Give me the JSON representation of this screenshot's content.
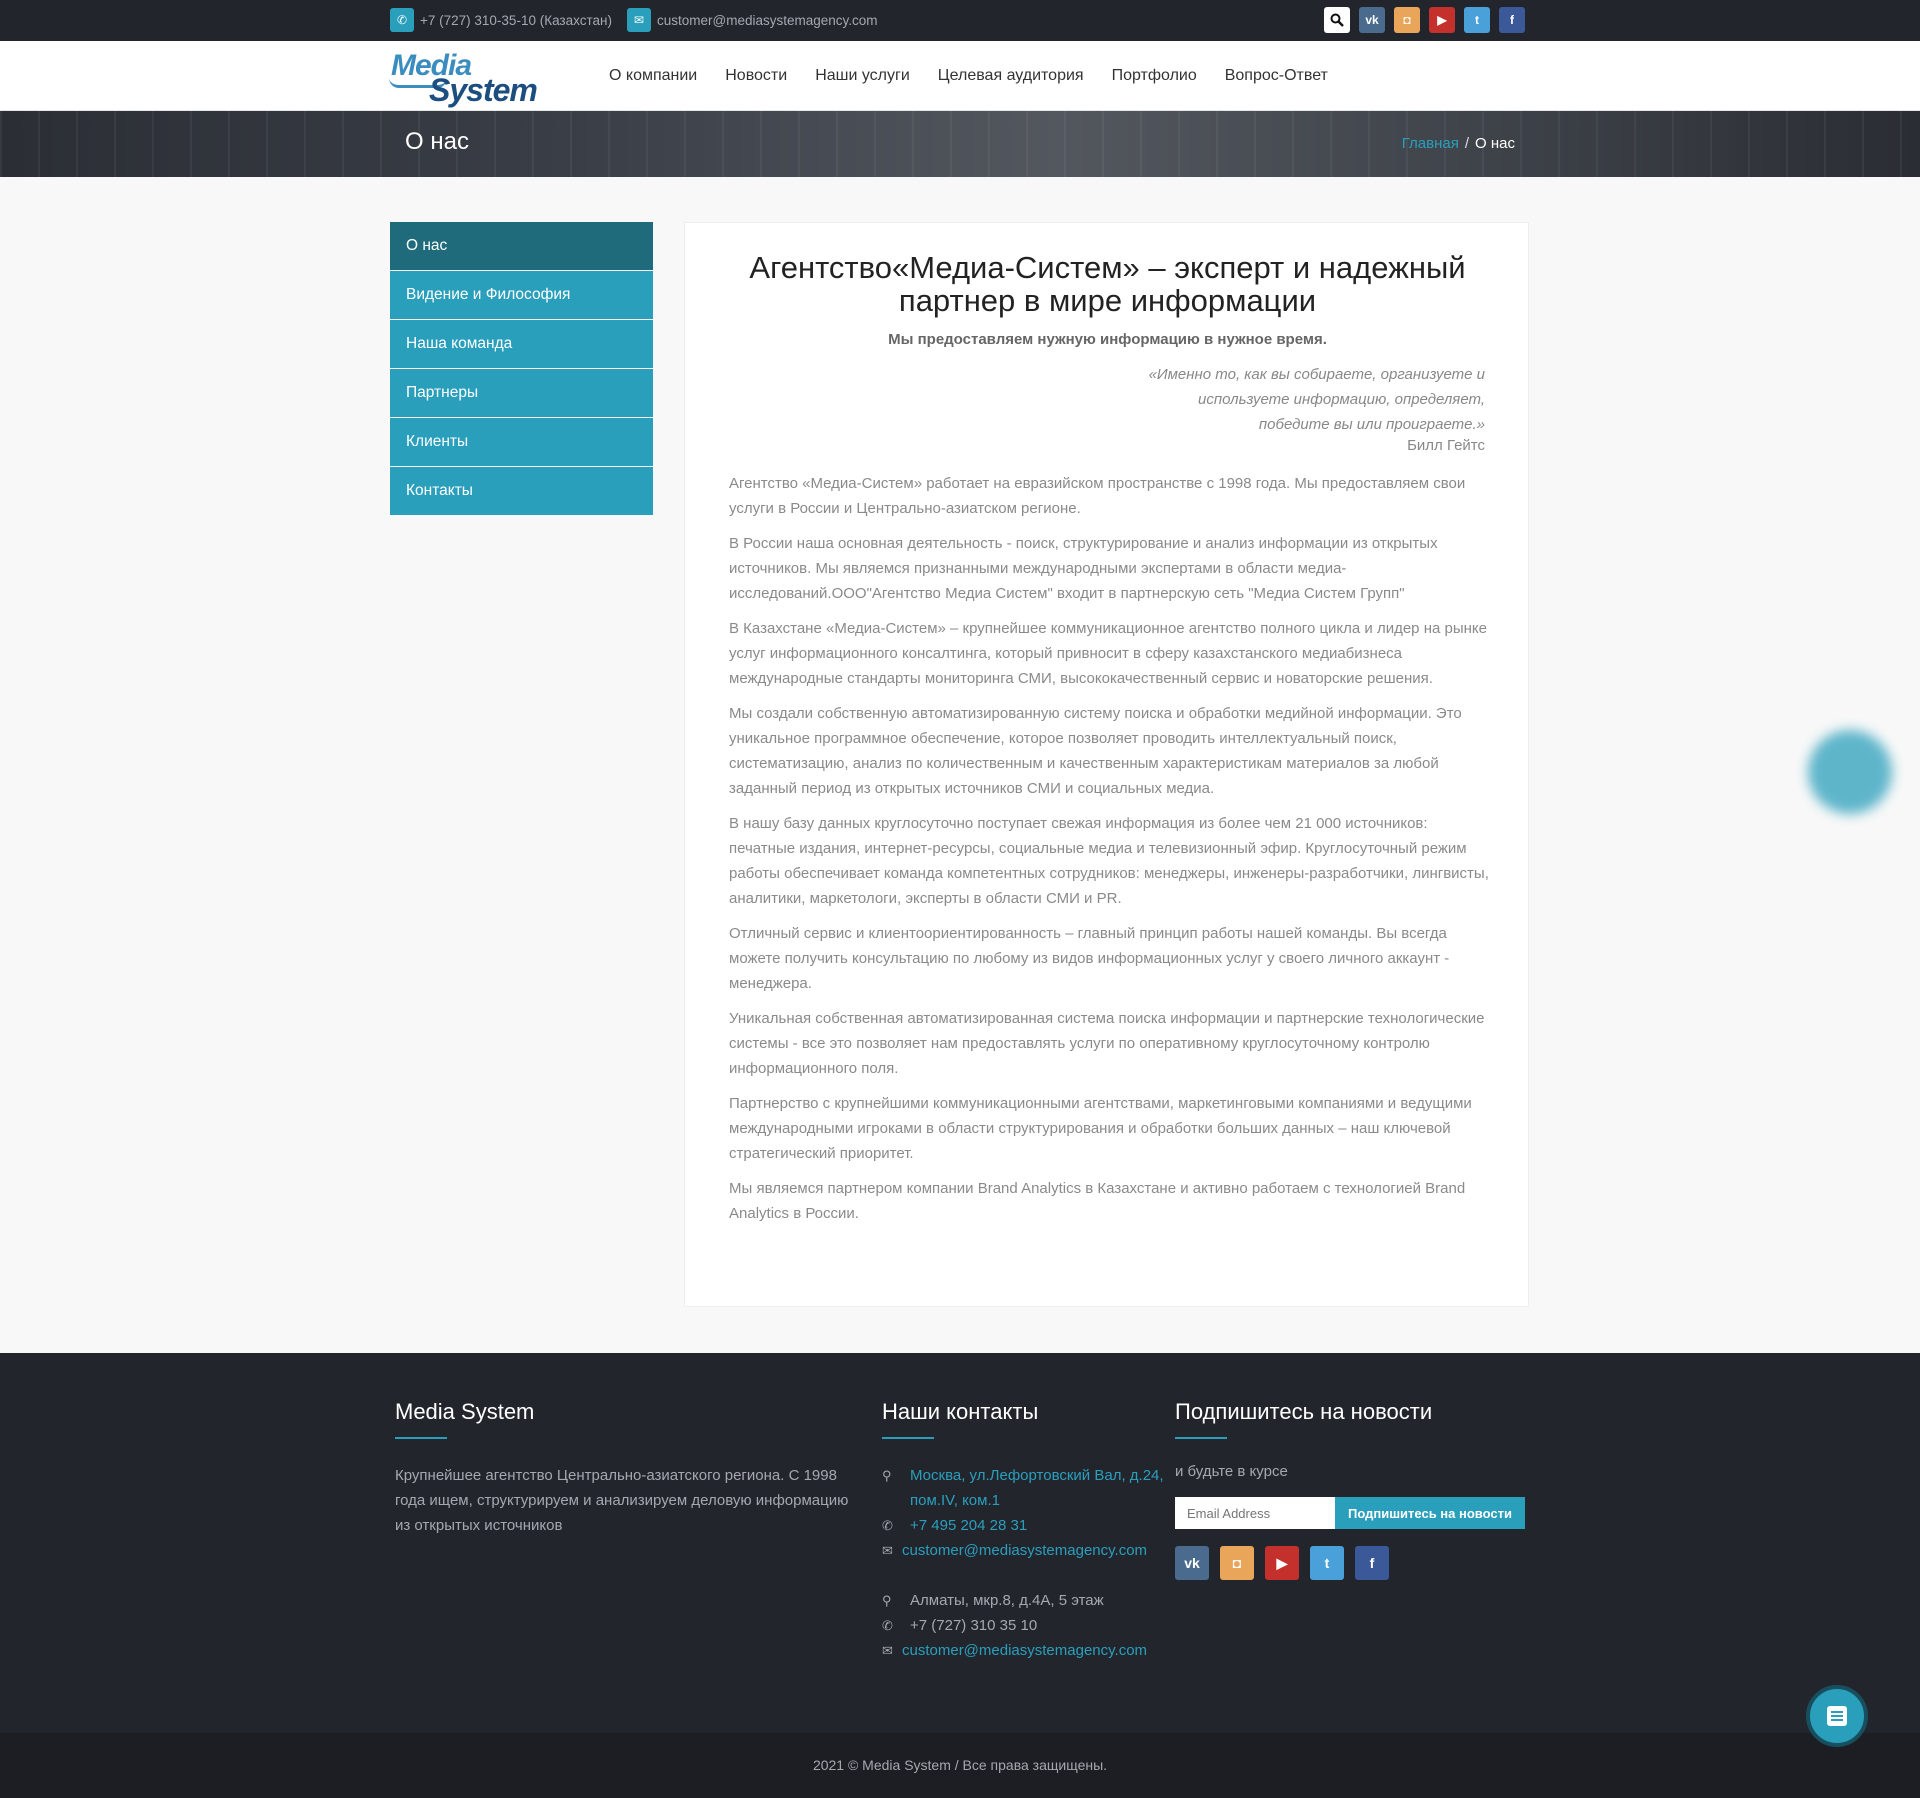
{
  "topbar": {
    "phone": "+7 (727) 310-35-10 (Казахстан)",
    "email": "customer@mediasystemagency.com",
    "icons": [
      "search-icon",
      "vk-icon",
      "instagram-icon",
      "youtube-icon",
      "twitter-icon",
      "facebook-icon"
    ]
  },
  "logo": {
    "line1": "Media",
    "line2": "System"
  },
  "nav": [
    "О компании",
    "Новости",
    "Наши услуги",
    "Целевая аудитория",
    "Портфолио",
    "Вопрос-Ответ"
  ],
  "page_title": "О нас",
  "breadcrumb": {
    "home": "Главная",
    "separator": "/",
    "current": "О нас"
  },
  "sidebar": [
    "О нас",
    "Видение и Философия",
    "Наша команда",
    "Партнеры",
    "Клиенты",
    "Контакты"
  ],
  "content": {
    "heading": "Агентство«Медиа-Систем» – эксперт и надежный партнер в мире информации",
    "lead": "Мы предоставляем нужную информацию в нужное время.",
    "quote": "«Именно то, как вы собираете, организуете и используете информацию, определяет, победите вы или проиграете.»",
    "quote_author": "Билл Гейтс",
    "paragraphs": [
      "Агентство «Медиа-Систем» работает на евразийском пространстве с 1998 года. Мы предоставляем свои услуги в России и Центрально-азиатском регионе.",
      "В России наша основная деятельность - поиск, структурирование и анализ информации из открытых источников. Мы являемся признанными международными экспертами в области медиа-исследований.ООО\"Агентство Медиа Систем\" входит в партнерскую сеть \"Медиа Систем Групп\"",
      "В Казахстане «Медиа-Систем» – крупнейшее коммуникационное агентство полного цикла и лидер на рынке услуг информационного консалтинга, который привносит в сферу казахстанского медиабизнеса международные стандарты мониторинга СМИ, высококачественный сервис и новаторские решения.",
      "Мы создали собственную автоматизированную систему поиска и обработки медийной информации. Это уникальное программное обеспечение, которое позволяет проводить интеллектуальный поиск, систематизацию, анализ по количественным и качественным характеристикам материалов за любой заданный период из открытых источников СМИ и социальных медиа.",
      "В нашу базу данных круглосуточно поступает свежая информация из более чем 21 000 источников: печатные издания, интернет-ресурсы, социальные медиа и телевизионный эфир. Круглосуточный режим работы обеспечивает команда компетентных сотрудников: менеджеры, инженеры-разработчики, лингвисты, аналитики, маркетологи, эксперты в области СМИ и PR.",
      "Отличный сервис и клиентоориентированность – главный принцип работы нашей команды. Вы всегда можете получить консультацию по любому из видов информационных услуг у своего личного аккаунт - менеджера.",
      "Уникальная собственная автоматизированная система поиска информации и партнерские технологические системы - все это позволяет нам предоставлять услуги по оперативному круглосуточному контролю информационного поля.",
      "Партнерство с крупнейшими коммуникационными агентствами, маркетинговыми компаниями и ведущими международными игроками в области структурирования и обработки больших данных – наш ключевой стратегический приоритет.",
      "Мы являемся партнером компании Brand Analytics в Казахстане и активно работаем с технологией Brand Analytics в России."
    ]
  },
  "footer": {
    "about_title": "Media System",
    "about_text": "Крупнейшее агентство Центрально-азиатского региона. С 1998 года ищем, структурируем и анализируем деловую информацию из открытых источников",
    "contacts_title": "Наши контакты",
    "moscow_address": "Москва, ул.Лефортовский Вал, д.24, пом.IV, ком.1",
    "moscow_phone": "+7 495 204 28 31",
    "moscow_email": "customer@mediasystemagency.com",
    "almaty_address": "Алматы, мкр.8, д.4А, 5 этаж",
    "almaty_phone": "+7 (727) 310 35 10",
    "almaty_email": "customer@mediasystemagency.com",
    "subscribe_title": "Подпишитесь на новости",
    "subscribe_text": "и будьте в курсе",
    "email_placeholder": "Email Address",
    "subscribe_button": "Подпишитесь на новости",
    "icons": [
      "vk-icon",
      "instagram-icon",
      "youtube-icon",
      "twitter-icon",
      "facebook-icon"
    ]
  },
  "copyright": "2021 © Media System / Все права защищены.",
  "colors": {
    "accent": "#2a9fbc",
    "accent_dark": "#1f6b7c",
    "dark_bg": "#23252d"
  }
}
